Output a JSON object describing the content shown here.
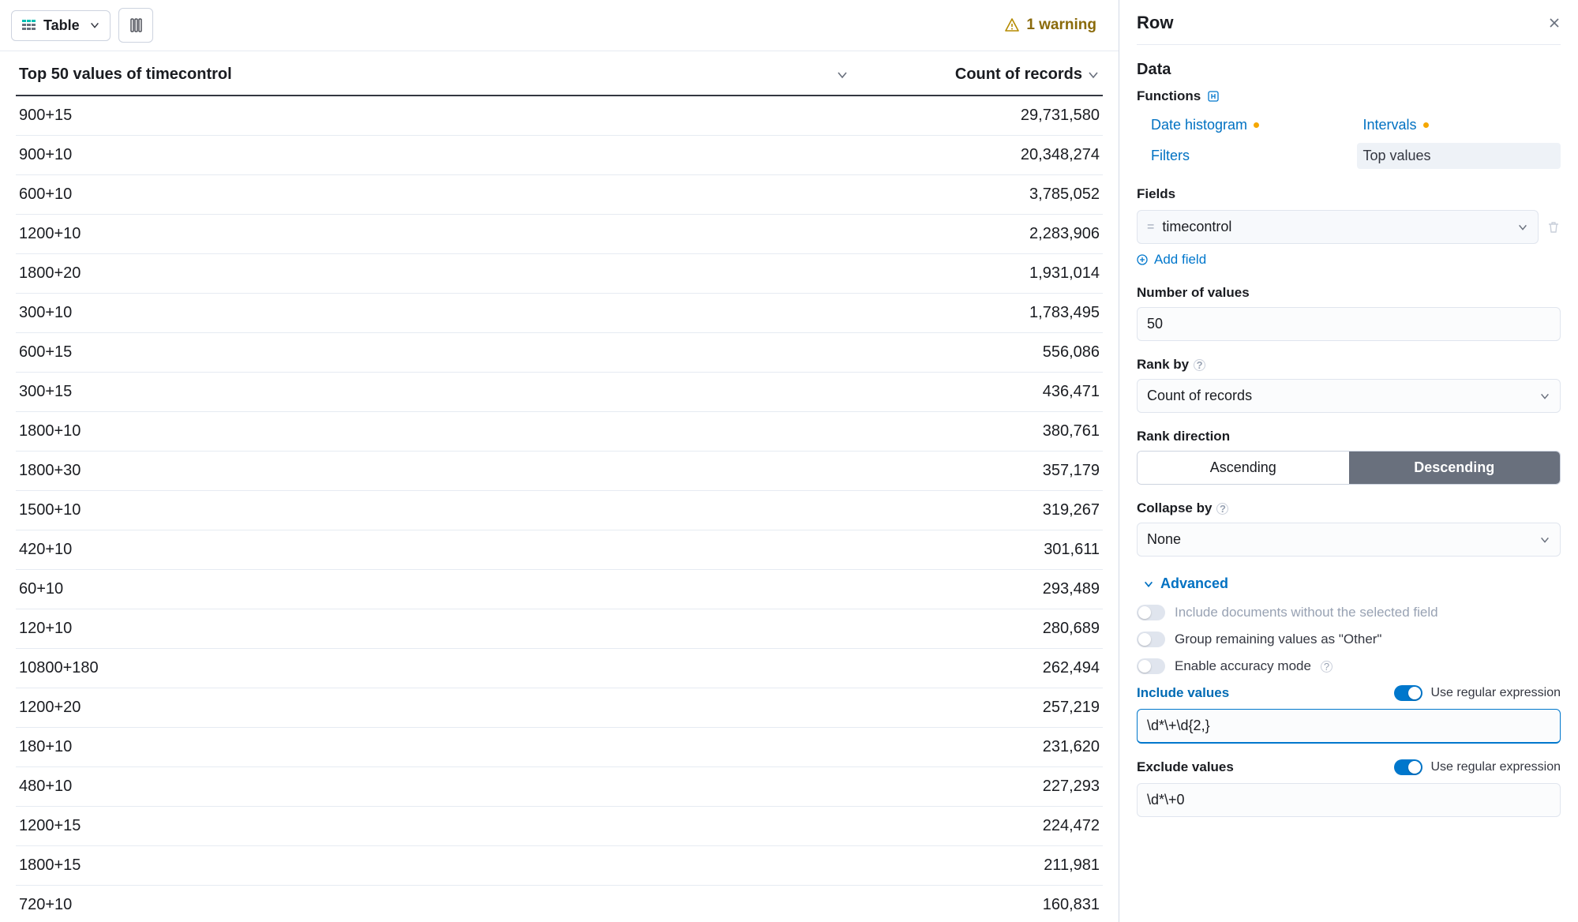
{
  "toolbar": {
    "view_label": "Table",
    "warning_text": "1 warning"
  },
  "table": {
    "col1_header": "Top 50 values of timecontrol",
    "col2_header": "Count of records",
    "rows": [
      {
        "k": "900+15",
        "v": "29,731,580"
      },
      {
        "k": "900+10",
        "v": "20,348,274"
      },
      {
        "k": "600+10",
        "v": "3,785,052"
      },
      {
        "k": "1200+10",
        "v": "2,283,906"
      },
      {
        "k": "1800+20",
        "v": "1,931,014"
      },
      {
        "k": "300+10",
        "v": "1,783,495"
      },
      {
        "k": "600+15",
        "v": "556,086"
      },
      {
        "k": "300+15",
        "v": "436,471"
      },
      {
        "k": "1800+10",
        "v": "380,761"
      },
      {
        "k": "1800+30",
        "v": "357,179"
      },
      {
        "k": "1500+10",
        "v": "319,267"
      },
      {
        "k": "420+10",
        "v": "301,611"
      },
      {
        "k": "60+10",
        "v": "293,489"
      },
      {
        "k": "120+10",
        "v": "280,689"
      },
      {
        "k": "10800+180",
        "v": "262,494"
      },
      {
        "k": "1200+20",
        "v": "257,219"
      },
      {
        "k": "180+10",
        "v": "231,620"
      },
      {
        "k": "480+10",
        "v": "227,293"
      },
      {
        "k": "1200+15",
        "v": "224,472"
      },
      {
        "k": "1800+15",
        "v": "211,981"
      },
      {
        "k": "720+10",
        "v": "160,831"
      }
    ]
  },
  "panel": {
    "title": "Row",
    "data_label": "Data",
    "functions_label": "Functions",
    "functions": {
      "date_histogram": "Date histogram",
      "intervals": "Intervals",
      "filters": "Filters",
      "top_values": "Top values"
    },
    "fields_label": "Fields",
    "field_value": "timecontrol",
    "add_field": "Add field",
    "num_values_label": "Number of values",
    "num_values": "50",
    "rank_by_label": "Rank by",
    "rank_by_value": "Count of records",
    "rank_dir_label": "Rank direction",
    "asc": "Ascending",
    "desc": "Descending",
    "collapse_label": "Collapse by",
    "collapse_value": "None",
    "advanced": "Advanced",
    "sw_include_missing": "Include documents without the selected field",
    "sw_group_other": "Group remaining values as \"Other\"",
    "sw_accuracy": "Enable accuracy mode",
    "include_label": "Include values",
    "regex_label": "Use regular expression",
    "include_value": "\\d*\\+\\d{2,}",
    "exclude_label": "Exclude values",
    "exclude_value": "\\d*\\+0"
  }
}
